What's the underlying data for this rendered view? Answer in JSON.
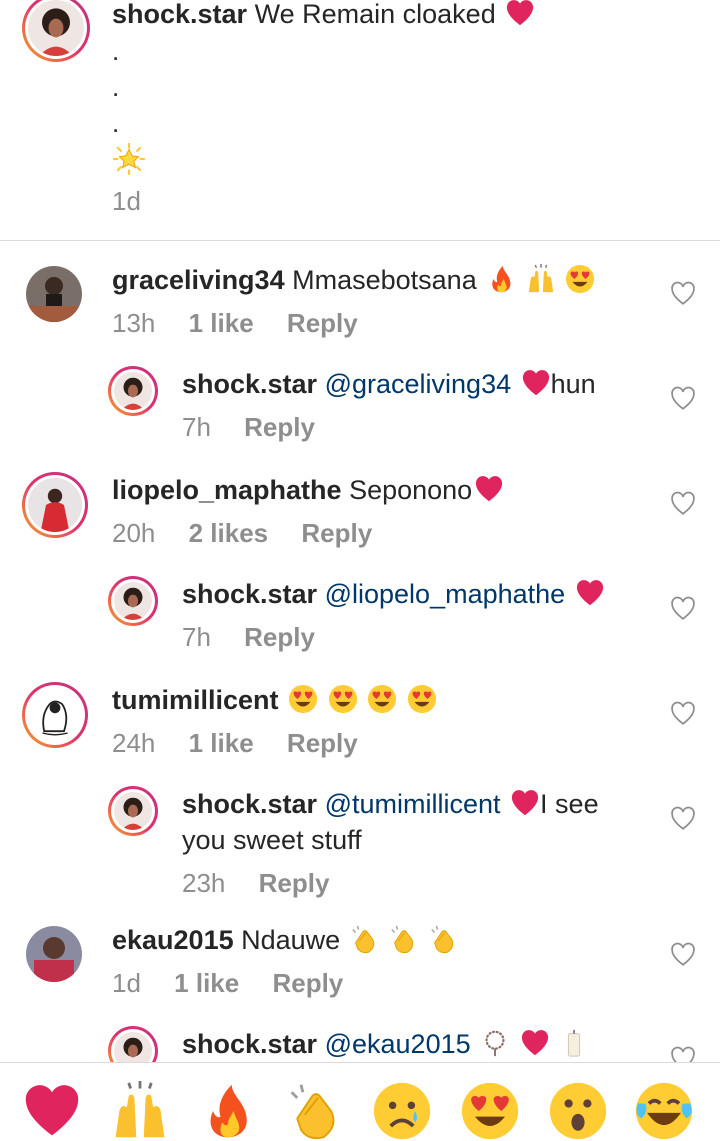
{
  "caption": {
    "username": "shock.star",
    "text": "We Remain  cloaked",
    "dots": [
      ".",
      ".",
      "."
    ],
    "time": "1d"
  },
  "comments": [
    {
      "username": "graceliving34",
      "text": "Mmasebotsana",
      "emojis": [
        "fire",
        "raising-hands",
        "heart-eyes"
      ],
      "time": "13h",
      "likes": "1 like",
      "reply": "Reply",
      "replies": [
        {
          "username": "shock.star",
          "mention": "@graceliving34",
          "text": "hun",
          "emojis_before": [
            "red-heart"
          ],
          "time": "7h",
          "reply": "Reply"
        }
      ]
    },
    {
      "username": "liopelo_maphathe",
      "text": "Seponono",
      "emojis": [
        "red-heart"
      ],
      "time": "20h",
      "likes": "2 likes",
      "reply": "Reply",
      "replies": [
        {
          "username": "shock.star",
          "mention": "@liopelo_maphathe",
          "text": "",
          "emojis_before": [
            "red-heart"
          ],
          "time": "7h",
          "reply": "Reply"
        }
      ]
    },
    {
      "username": "tumimillicent",
      "text": "",
      "emojis": [
        "heart-eyes",
        "heart-eyes",
        "heart-eyes",
        "heart-eyes"
      ],
      "time": "24h",
      "likes": "1 like",
      "reply": "Reply",
      "replies": [
        {
          "username": "shock.star",
          "mention": "@tumimillicent",
          "text": "I see",
          "text2": "you sweet stuff",
          "emojis_before": [
            "red-heart"
          ],
          "time": "23h",
          "reply": "Reply"
        }
      ]
    },
    {
      "username": "ekau2015",
      "text": "Ndauwe",
      "emojis": [
        "clapping",
        "clapping",
        "clapping"
      ],
      "time": "1d",
      "likes": "1 like",
      "reply": "Reply",
      "replies": [
        {
          "username": "shock.star",
          "mention": "@ekau2015",
          "text": "",
          "emojis_before": [
            "prayer-beads",
            "red-heart",
            "candle"
          ]
        }
      ]
    }
  ],
  "quick_reactions": [
    "red-heart",
    "raising-hands",
    "fire",
    "clapping",
    "sad-face",
    "heart-eyes",
    "surprised-face",
    "tears-of-joy"
  ],
  "colors": {
    "text": "#262626",
    "secondary": "#8e8e8e",
    "mention": "#00376b",
    "heart": "#e0245e"
  }
}
